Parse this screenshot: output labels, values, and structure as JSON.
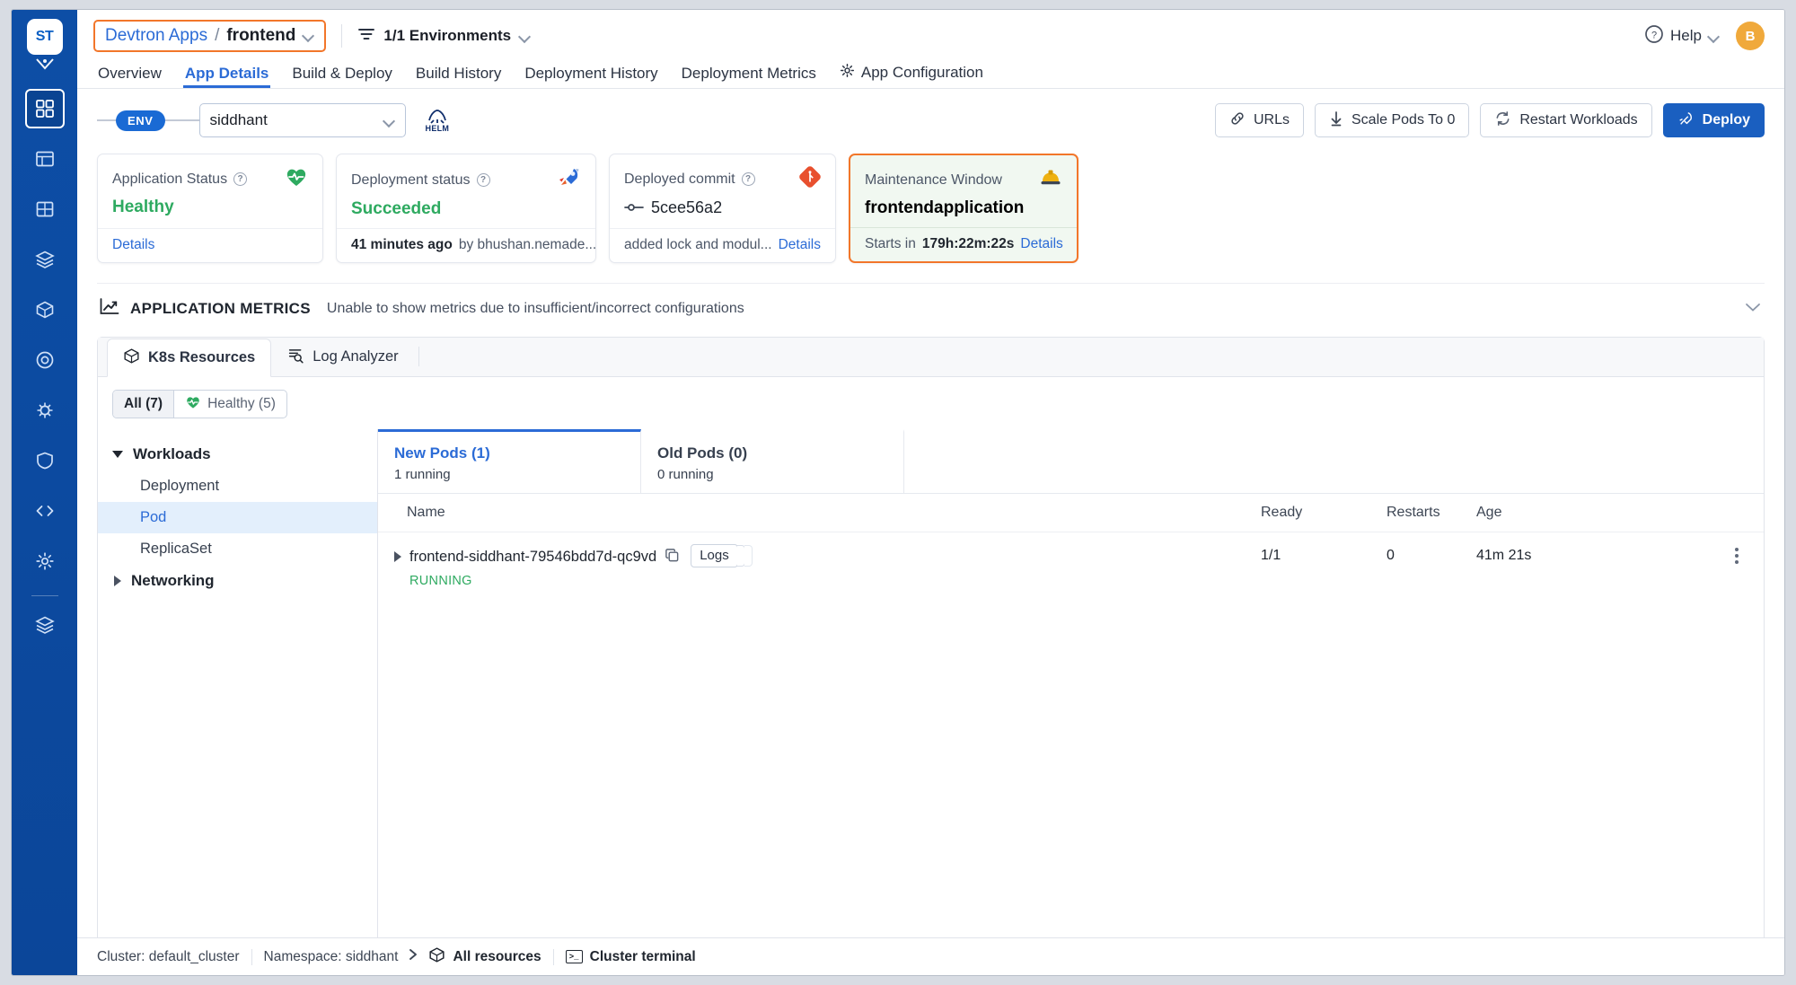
{
  "rail": {
    "logo_text": "ST",
    "items": [
      {
        "name": "applications",
        "icon": "grid-apps-icon",
        "active": true
      },
      {
        "name": "jobs",
        "icon": "table-icon",
        "active": false
      },
      {
        "name": "app-groups",
        "icon": "squares-icon",
        "active": false
      },
      {
        "name": "clusters",
        "icon": "layers-icon",
        "active": false
      },
      {
        "name": "charts",
        "icon": "cube-icon",
        "active": false
      },
      {
        "name": "bulk-edit",
        "icon": "target-icon",
        "active": false
      },
      {
        "name": "resource-browser",
        "icon": "bug-icon",
        "active": false
      },
      {
        "name": "security",
        "icon": "shield-icon",
        "active": false
      },
      {
        "name": "code",
        "icon": "code-icon",
        "active": false
      },
      {
        "name": "global-config",
        "icon": "gear-icon",
        "active": false
      },
      {
        "name": "stacks",
        "icon": "stack-icon",
        "active": false
      }
    ]
  },
  "header": {
    "app_group_label": "Devtron Apps",
    "separator": "/",
    "app_name": "frontend",
    "environments_label": "1/1 Environments",
    "help_label": "Help",
    "avatar_initial": "B"
  },
  "nav_tabs": [
    {
      "label": "Overview",
      "active": false,
      "icon": null
    },
    {
      "label": "App Details",
      "active": true,
      "icon": null
    },
    {
      "label": "Build & Deploy",
      "active": false,
      "icon": null
    },
    {
      "label": "Build History",
      "active": false,
      "icon": null
    },
    {
      "label": "Deployment History",
      "active": false,
      "icon": null
    },
    {
      "label": "Deployment Metrics",
      "active": false,
      "icon": null
    },
    {
      "label": "App Configuration",
      "active": false,
      "icon": "gear-icon"
    }
  ],
  "env_row": {
    "badge": "ENV",
    "selected_env": "siddhant",
    "helm_label": "HELM",
    "actions": [
      {
        "label": "URLs",
        "icon": "link-icon",
        "primary": false
      },
      {
        "label": "Scale Pods To 0",
        "icon": "scale-down-icon",
        "primary": false
      },
      {
        "label": "Restart Workloads",
        "icon": "refresh-icon",
        "primary": false
      },
      {
        "label": "Deploy",
        "icon": "rocket-icon",
        "primary": true
      }
    ]
  },
  "cards": {
    "application_status": {
      "title": "Application Status",
      "value": "Healthy",
      "footer_link": "Details",
      "icon": "heartbeat-icon"
    },
    "deployment_status": {
      "title": "Deployment status",
      "value": "Succeeded",
      "footer_time": "41 minutes ago",
      "footer_by": "by bhushan.nemade...",
      "icon": "rocket-status-icon"
    },
    "deployed_commit": {
      "title": "Deployed commit",
      "commit_hash": "5cee56a2",
      "footer_message": "added lock and modul...",
      "footer_link": "Details",
      "icon": "git-icon"
    },
    "maintenance_window": {
      "title": "Maintenance Window",
      "value": "frontendapplication",
      "footer_prefix": "Starts in",
      "footer_timer": "179h:22m:22s",
      "footer_link": "Details",
      "icon": "hardhat-icon"
    }
  },
  "application_metrics": {
    "title": "APPLICATION METRICS",
    "note": "Unable to show metrics due to insufficient/incorrect configurations",
    "icon": "trend-up-icon"
  },
  "resource_panel": {
    "tabs": [
      {
        "label": "K8s Resources",
        "icon": "cube-icon",
        "active": true
      },
      {
        "label": "Log Analyzer",
        "icon": "log-search-icon",
        "active": false
      }
    ],
    "filters": [
      {
        "label": "All (7)",
        "icon": null,
        "active": true
      },
      {
        "label": "Healthy (5)",
        "icon": "heartbeat-icon",
        "active": false
      }
    ],
    "tree": [
      {
        "group": "Workloads",
        "expanded": true,
        "items": [
          {
            "label": "Deployment",
            "active": false
          },
          {
            "label": "Pod",
            "active": true
          },
          {
            "label": "ReplicaSet",
            "active": false
          }
        ]
      },
      {
        "group": "Networking",
        "expanded": false,
        "items": []
      }
    ],
    "pod_tabs": [
      {
        "label": "New Pods (1)",
        "sub": "1 running",
        "active": true
      },
      {
        "label": "Old Pods (0)",
        "sub": "0 running",
        "active": false
      }
    ],
    "table": {
      "columns": [
        "Name",
        "Ready",
        "Restarts",
        "Age"
      ],
      "rows": [
        {
          "name": "frontend-siddhant-79546bdd7d-qc9vd",
          "status": "RUNNING",
          "logs_label": "Logs",
          "ready": "1/1",
          "restarts": "0",
          "age": "41m 21s"
        }
      ]
    }
  },
  "footer": {
    "cluster": "Cluster: default_cluster",
    "namespace": "Namespace: siddhant",
    "all_resources": "All resources",
    "cluster_terminal": "Cluster terminal"
  },
  "colors": {
    "accent_blue": "#2b6bd6",
    "primary_blue": "#1a5fc0",
    "rail_blue": "#0b4a9c",
    "highlight_orange": "#f2762a",
    "success_green": "#2eaa60",
    "maintenance_bg": "#f1f8f1"
  }
}
